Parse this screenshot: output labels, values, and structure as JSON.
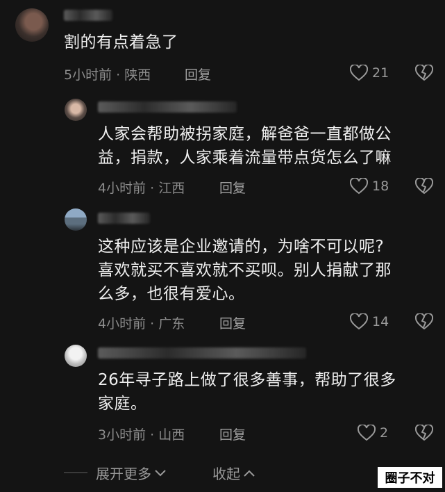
{
  "comments": [
    {
      "text": "割的有点着急了",
      "meta": "5小时前 · 陕西",
      "reply": "回复",
      "likes": "21"
    },
    {
      "text": "人家会帮助被拐家庭，解爸爸一直都做公\n益，捐款，人家乘着流量带点货怎么了嘛",
      "meta": "4小时前 · 江西",
      "reply": "回复",
      "likes": "18"
    },
    {
      "text": "这种应该是企业邀请的，为啥不可以呢?\n喜欢就买不喜欢就不买呗。别人捐献了那\n么多，也很有爱心。",
      "meta": "4小时前 · 广东",
      "reply": "回复",
      "likes": "14"
    },
    {
      "text": "26年寻子路上做了很多善事，帮助了很多\n家庭。",
      "meta": "3小时前 · 山西",
      "reply": "回复",
      "likes": "2"
    }
  ],
  "footer": {
    "expand": "展开更多",
    "collapse": "收起"
  },
  "watermark": "圈子不对",
  "icons": {
    "like": "heart-icon",
    "dislike": "broken-heart-icon",
    "expand": "chevron-down-icon",
    "collapse": "chevron-up-icon"
  }
}
